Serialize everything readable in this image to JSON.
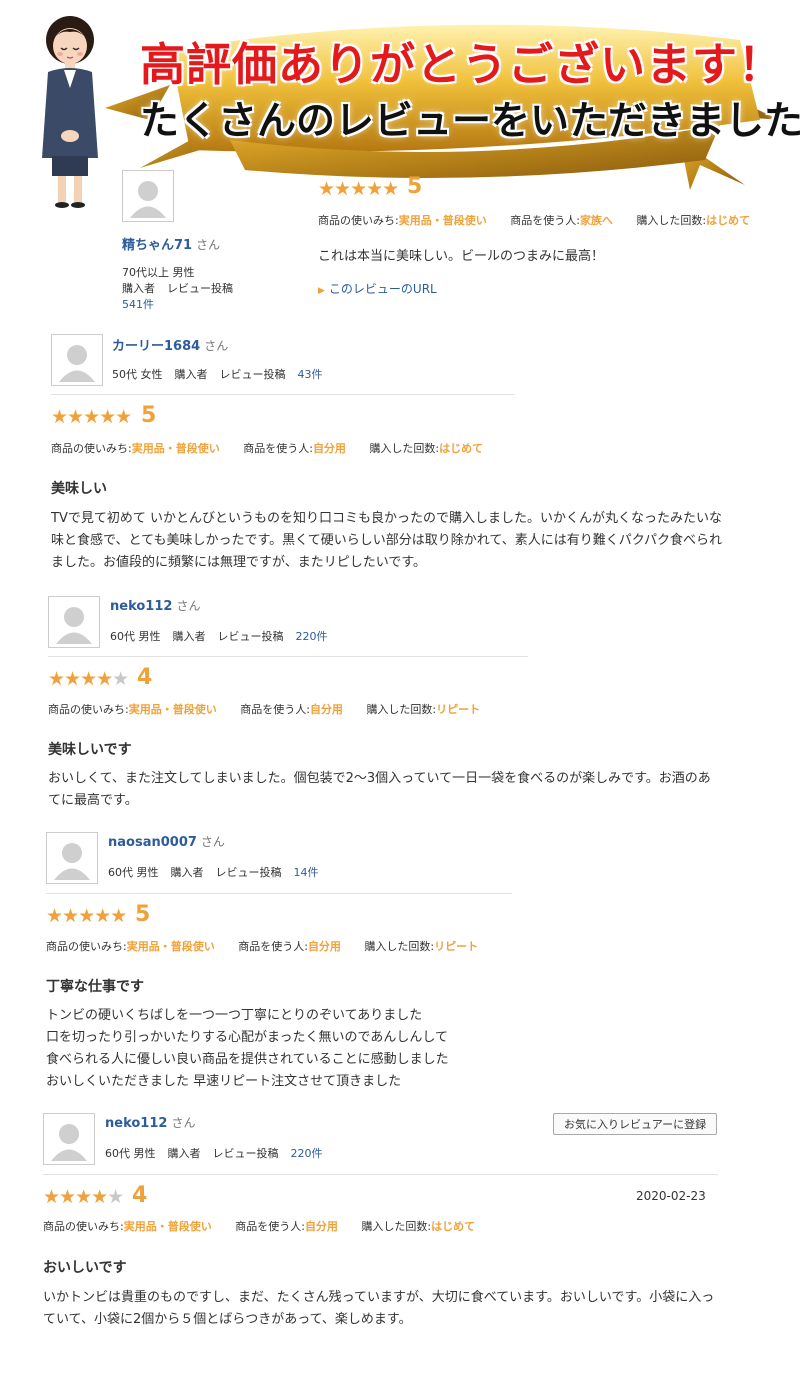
{
  "banner": {
    "title1": "高評価ありがとうございます！",
    "title2": "たくさんのレビューをいただきました"
  },
  "labels": {
    "san": "さん",
    "usage": "商品の使いみち:",
    "user": "商品を使う人:",
    "times": "購入した回数:",
    "buyer": "購入者",
    "posts": "レビュー投稿",
    "review_url": "このレビューのURL",
    "fav_button": "お気に入りレビュアーに登録"
  },
  "reviews": [
    {
      "name": "精ちゃん71",
      "age_gender": "70代以上 男性",
      "count": "541件",
      "stars": 5,
      "score": "5",
      "usage": "実用品・普段使い",
      "user": "家族へ",
      "times": "はじめて",
      "body": "これは本当に美味しい。ビールのつまみに最高！"
    },
    {
      "name": "カーリー1684",
      "age_gender": "50代 女性",
      "count": "43件",
      "stars": 5,
      "score": "5",
      "usage": "実用品・普段使い",
      "user": "自分用",
      "times": "はじめて",
      "title": "美味しい",
      "body": "TVで見て初めて いかとんびというものを知り口コミも良かったので購入しました。いかくんが丸くなったみたいな味と食感で、とても美味しかったです。黒くて硬いらしい部分は取り除かれて、素人には有り難くパクパク食べられました。お値段的に頻繁には無理ですが、またリピしたいです。"
    },
    {
      "name": "neko112",
      "age_gender": "60代 男性",
      "count": "220件",
      "stars": 4,
      "score": "4",
      "usage": "実用品・普段使い",
      "user": "自分用",
      "times": "リピート",
      "title": "美味しいです",
      "body": "おいしくて、また注文してしまいました。個包装で2〜3個入っていて一日一袋を食べるのが楽しみです。お酒のあてに最高です。"
    },
    {
      "name": "naosan0007",
      "age_gender": "60代 男性",
      "count": "14件",
      "stars": 5,
      "score": "5",
      "usage": "実用品・普段使い",
      "user": "自分用",
      "times": "リピート",
      "title": "丁寧な仕事です",
      "body_lines": [
        "トンビの硬いくちばしを一つ一つ丁寧にとりのぞいてありました",
        "口を切ったり引っかいたりする心配がまったく無いのであんしんして",
        "食べられる人に優しい良い商品を提供されていることに感動しました",
        "おいしくいただきました 早速リピート注文させて頂きました"
      ]
    },
    {
      "name": "neko112",
      "age_gender": "60代 男性",
      "count": "220件",
      "stars": 4,
      "score": "4",
      "date": "2020-02-23",
      "usage": "実用品・普段使い",
      "user": "自分用",
      "times": "はじめて",
      "title": "おいしいです",
      "body": "いかトンビは貴重のものですし、まだ、たくさん残っていますが、大切に食べています。おいしいです。小袋に入っていて、小袋に2個から５個とばらつきがあって、楽しめます。"
    }
  ],
  "colors": {
    "accent": "#f0a23a",
    "link": "#2d5c9a",
    "banner_red": "#e4191c",
    "gold": "#d9a21b"
  },
  "icons": {
    "avatar": "user-silhouette-icon",
    "star": "star-icon",
    "link_marker": "triangle-right-icon"
  }
}
